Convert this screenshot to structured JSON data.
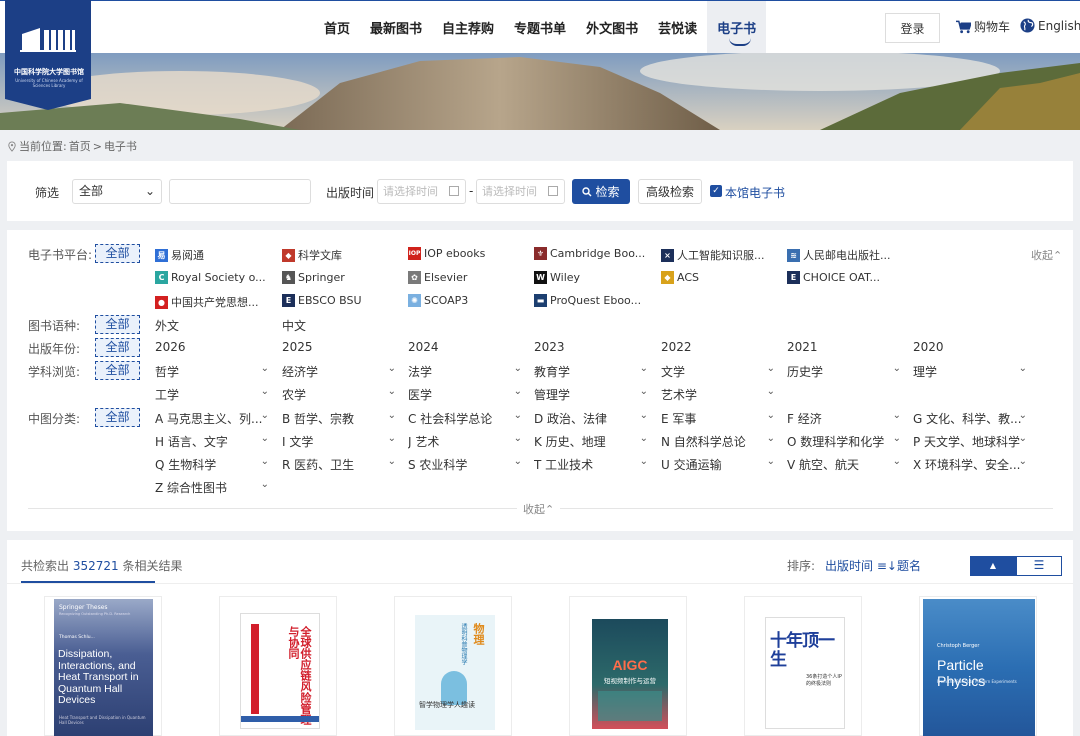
{
  "header": {
    "logo_name": "中国科学院大学图书馆",
    "logo_sub": "University of Chinese Academy of Sciences Library",
    "nav": [
      {
        "label": "首页",
        "active": false
      },
      {
        "label": "最新图书",
        "active": false
      },
      {
        "label": "自主荐购",
        "active": false
      },
      {
        "label": "专题书单",
        "active": false
      },
      {
        "label": "外文图书",
        "active": false
      },
      {
        "label": "芸悦读",
        "active": false
      },
      {
        "label": "电子书",
        "active": true
      }
    ],
    "login": "登录",
    "cart": "购物车",
    "lang": "English",
    "accent": "#1f4ea0"
  },
  "breadcrumb": {
    "prefix": "当前位置:",
    "home": "首页",
    "sep": ">",
    "current": "电子书"
  },
  "search": {
    "filter_label": "筛选",
    "filter_value": "全部",
    "keyword_value": "",
    "date_label": "出版时间",
    "date_from_placeholder": "请选择时间",
    "date_sep": "-",
    "date_to_placeholder": "请选择时间",
    "search_btn": "检索",
    "adv_btn": "高级检索",
    "checkbox_label": "本馆电子书",
    "checkbox_checked": true
  },
  "facets": {
    "all": "全部",
    "collapse_right": "收起",
    "collapse_bottom": "收起",
    "platform": {
      "label": "电子书平台:",
      "items": [
        {
          "name": "易阅通",
          "icon": "eyuetong-icon",
          "color": "#2f6fd6",
          "glyph": "易"
        },
        {
          "name": "科学文库",
          "icon": "kexuewenku-icon",
          "color": "#c0392b",
          "glyph": "◆"
        },
        {
          "name": "IOP ebooks",
          "icon": "iop-icon",
          "color": "#d0221b",
          "glyph": "IOP"
        },
        {
          "name": "Cambridge Boo...",
          "icon": "cambridge-icon",
          "color": "#8a2b2b",
          "glyph": "⚜"
        },
        {
          "name": "人工智能知识服...",
          "icon": "ai-knowledge-icon",
          "color": "#1c2f5a",
          "glyph": "⨯"
        },
        {
          "name": "人民邮电出版社...",
          "icon": "ptpress-icon",
          "color": "#3a6fb0",
          "glyph": "≋"
        },
        {
          "name": "Royal Society o...",
          "icon": "royal-society-icon",
          "color": "#2aa6a0",
          "glyph": "C"
        },
        {
          "name": "Springer",
          "icon": "springer-icon",
          "color": "#555555",
          "glyph": "♞"
        },
        {
          "name": "Elsevier",
          "icon": "elsevier-icon",
          "color": "#7a7a7a",
          "glyph": "✿"
        },
        {
          "name": "Wiley",
          "icon": "wiley-icon",
          "color": "#111111",
          "glyph": "W"
        },
        {
          "name": "ACS",
          "icon": "acs-icon",
          "color": "#d8a21b",
          "glyph": "◆"
        },
        {
          "name": "CHOICE OAT...",
          "icon": "choice-icon",
          "color": "#1c2f5a",
          "glyph": "E"
        },
        {
          "name": "中国共产党思想...",
          "icon": "ccp-thought-icon",
          "color": "#d32020",
          "glyph": "●"
        },
        {
          "name": "EBSCO BSU",
          "icon": "ebsco-icon",
          "color": "#1c2f5a",
          "glyph": "E"
        },
        {
          "name": "SCOAP3",
          "icon": "scoap3-icon",
          "color": "#7ab0e0",
          "glyph": "✺"
        },
        {
          "name": "ProQuest Eboo...",
          "icon": "proquest-icon",
          "color": "#1c3f70",
          "glyph": "▬"
        }
      ]
    },
    "language": {
      "label": "图书语种:",
      "items": [
        "外文",
        "中文"
      ]
    },
    "year": {
      "label": "出版年份:",
      "items": [
        "2026",
        "2025",
        "2024",
        "2023",
        "2022",
        "2021",
        "2020"
      ]
    },
    "subject": {
      "label": "学科浏览:",
      "items": [
        "哲学",
        "经济学",
        "法学",
        "教育学",
        "文学",
        "历史学",
        "理学",
        "工学",
        "农学",
        "医学",
        "管理学",
        "艺术学"
      ]
    },
    "clc": {
      "label": "中图分类:",
      "items": [
        "A 马克思主义、列...",
        "B 哲学、宗教",
        "C 社会科学总论",
        "D 政治、法律",
        "E 军事",
        "F 经济",
        "G 文化、科学、教...",
        "H 语言、文字",
        "I 文学",
        "J 艺术",
        "K 历史、地理",
        "N 自然科学总论",
        "O 数理科学和化学",
        "P 天文学、地球科学",
        "Q 生物科学",
        "R 医药、卫生",
        "S 农业科学",
        "T 工业技术",
        "U 交通运输",
        "V 航空、航天",
        "X 环境科学、安全...",
        "Z 综合性图书"
      ]
    }
  },
  "results": {
    "prefix": "共检索出",
    "count": "352721",
    "suffix": "条相关结果",
    "sort_label": "排序:",
    "sort_date": "出版时间",
    "sort_title": "题名",
    "view_grid_icon": "arrow-up-icon",
    "view_list_icon": "list-icon"
  },
  "books": [
    {
      "series": "Springer Theses",
      "series_sub": "Recognizing Outstanding Ph.D. Research",
      "author": "Thomas Schlu...",
      "title": "Dissipation, Interactions, and Heat Transport in Quantum Hall Devices",
      "sub": "Heat Transport and Dissipation in Quantum Hall Devices"
    },
    {
      "title": "全球供应链风险管理与协同"
    },
    {
      "title": "物理",
      "sub": "透明科普物理学",
      "tagline": "智学物理学人趣读"
    },
    {
      "title": "AIGC",
      "sub": "短视频制作与运营"
    },
    {
      "title": "十年顶一生",
      "sub": "36条打造个人IP的终极法则"
    },
    {
      "author": "Christoph Berger",
      "title": "Particle Physics",
      "sub": "From the Basics to Modern Experiments"
    }
  ]
}
